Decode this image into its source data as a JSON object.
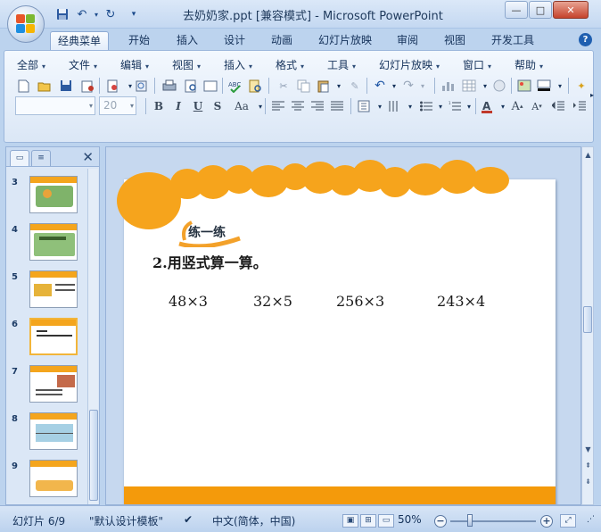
{
  "window": {
    "title": "去奶奶家.ppt [兼容模式] - Microsoft PowerPoint",
    "controls": {
      "minimize": "—",
      "maximize": "□",
      "close": "✕"
    }
  },
  "quick_access": {
    "save_icon": "save-icon",
    "undo_icon": "undo-icon",
    "redo_icon": "redo-icon",
    "customize": "▾"
  },
  "ribbon_tabs": [
    "经典菜单",
    "开始",
    "插入",
    "设计",
    "动画",
    "幻灯片放映",
    "审阅",
    "视图",
    "开发工具"
  ],
  "active_tab": "经典菜单",
  "classic_menu": [
    "全部",
    "文件",
    "编辑",
    "视图",
    "插入",
    "格式",
    "工具",
    "幻灯片放映",
    "窗口",
    "帮助"
  ],
  "font": {
    "name": "",
    "size": "20"
  },
  "format_buttons": [
    "B",
    "I",
    "U",
    "S",
    "Aa"
  ],
  "slide_panel": {
    "thumbnails": [
      {
        "number": "3"
      },
      {
        "number": "4"
      },
      {
        "number": "5"
      },
      {
        "number": "6"
      },
      {
        "number": "7"
      },
      {
        "number": "8"
      },
      {
        "number": "9"
      }
    ],
    "selected": "6"
  },
  "slide": {
    "badge": "练一练",
    "question": "2.用竖式算一算。",
    "expressions": [
      "48×3",
      "32×5",
      "256×3",
      "243×4"
    ],
    "theme_color": "#f6a41c"
  },
  "status_bar": {
    "slide_info": "幻灯片 6/9",
    "template": "\"默认设计模板\"",
    "language": "中文(简体，中国)",
    "zoom": "50%"
  }
}
